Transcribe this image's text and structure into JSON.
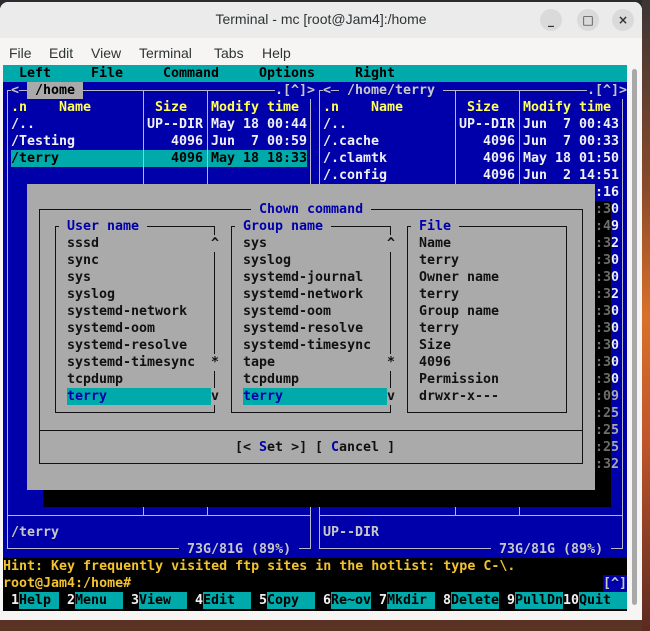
{
  "window": {
    "title": "Terminal - mc [root@Jam4]:/home",
    "buttons": {
      "minimize": "_",
      "maximize": "□",
      "close": "×"
    },
    "menubar": [
      "File",
      "Edit",
      "View",
      "Terminal",
      "Tabs",
      "Help"
    ]
  },
  "mc_menu": [
    "Left",
    "File",
    "Command",
    "Options",
    "Right"
  ],
  "left_panel": {
    "nav_left": "<",
    "path": " /home ",
    "scroll_indicator": ".[^]>",
    "columns": {
      "n": ".n",
      "name": "Name",
      "size": "Size",
      "time": "Modify time"
    },
    "rows": [
      {
        "name": "/..",
        "size": "UP--DIR",
        "time": "May 18 00:44"
      },
      {
        "name": "/Testing",
        "size": "4096",
        "time": "Jun  7 00:59"
      },
      {
        "name": "/terry",
        "size": "4096",
        "time": "May 18 18:33"
      }
    ],
    "selected": "/terry",
    "mini_status": "/terry",
    "disk": " 73G/81G (89%) "
  },
  "right_panel": {
    "nav_left": "<",
    "path": " /home/terry ",
    "scroll_indicator": ".[^]>",
    "columns": {
      "n": ".n",
      "name": "Name",
      "size": "Size",
      "time": "Modify time"
    },
    "rows": [
      {
        "name": "/..",
        "size": "UP--DIR",
        "time": "Jun  7 00:43"
      },
      {
        "name": "/.cache",
        "size": "4096",
        "time": "Jun  7 00:33"
      },
      {
        "name": "/.clamtk",
        "size": "4096",
        "time": "May 18 01:50"
      },
      {
        "name": "/.config",
        "size": "4096",
        "time": "Jun  2 14:51"
      }
    ],
    "partially_hidden_time_endings": [
      ":16",
      ":30",
      ":49",
      ":32",
      ":30",
      ":30",
      ":32",
      ":30",
      ":30",
      ":30",
      ":30",
      ":30",
      ":09",
      ":25",
      ":25",
      ":25",
      ":32"
    ],
    "mini_status": "UP--DIR",
    "disk": " 73G/81G (89%) "
  },
  "dialog": {
    "title": " Chown command ",
    "user_box": {
      "title": " User name ",
      "items": [
        "sssd",
        "sync",
        "sys",
        "syslog",
        "systemd-network",
        "systemd-oom",
        "systemd-resolve",
        "systemd-timesync",
        "tcpdump",
        "terry"
      ],
      "selected": "terry",
      "scroll": {
        "up": "^",
        "thumb": "*",
        "down": "v"
      }
    },
    "group_box": {
      "title": " Group name ",
      "items": [
        "sys",
        "syslog",
        "systemd-journal",
        "systemd-network",
        "systemd-oom",
        "systemd-resolve",
        "systemd-timesync",
        "tape",
        "tcpdump",
        "terry"
      ],
      "selected": "terry",
      "scroll": {
        "up": "^",
        "thumb": "*",
        "down": "v"
      }
    },
    "file_box": {
      "title": " File ",
      "lines": [
        "Name",
        "terry",
        "Owner name",
        "terry",
        "Group name",
        "terry",
        "Size",
        "4096",
        "Permission",
        "drwxr-x---"
      ]
    },
    "buttons": {
      "set": {
        "pre": "[< ",
        "hot": "S",
        "rest": "et",
        "post": " >]"
      },
      "cancel": {
        "pre": "[ ",
        "hot": "C",
        "rest": "ancel",
        "post": " ]"
      }
    }
  },
  "hint": "Hint: Key frequently visited ftp sites in the hotlist: type C-\\.",
  "prompt": "root@Jam4:/home#",
  "prompt_indicator": "[^]",
  "fkeys": [
    {
      "num": "1",
      "label": "Help"
    },
    {
      "num": "2",
      "label": "Menu"
    },
    {
      "num": "3",
      "label": "View"
    },
    {
      "num": "4",
      "label": "Edit"
    },
    {
      "num": "5",
      "label": "Copy"
    },
    {
      "num": "6",
      "label": "Re~ov"
    },
    {
      "num": "7",
      "label": "Mkdir"
    },
    {
      "num": "8",
      "label": "Delete"
    },
    {
      "num": "9",
      "label": "PullDn"
    },
    {
      "num": "10",
      "label": "Quit"
    }
  ],
  "colors": {
    "panel_bg": "#0000aa",
    "highlight": "#00aaaa",
    "dialog_bg": "#aaaaaa",
    "header_text": "#ffff55",
    "hint_text": "#f2c230"
  }
}
